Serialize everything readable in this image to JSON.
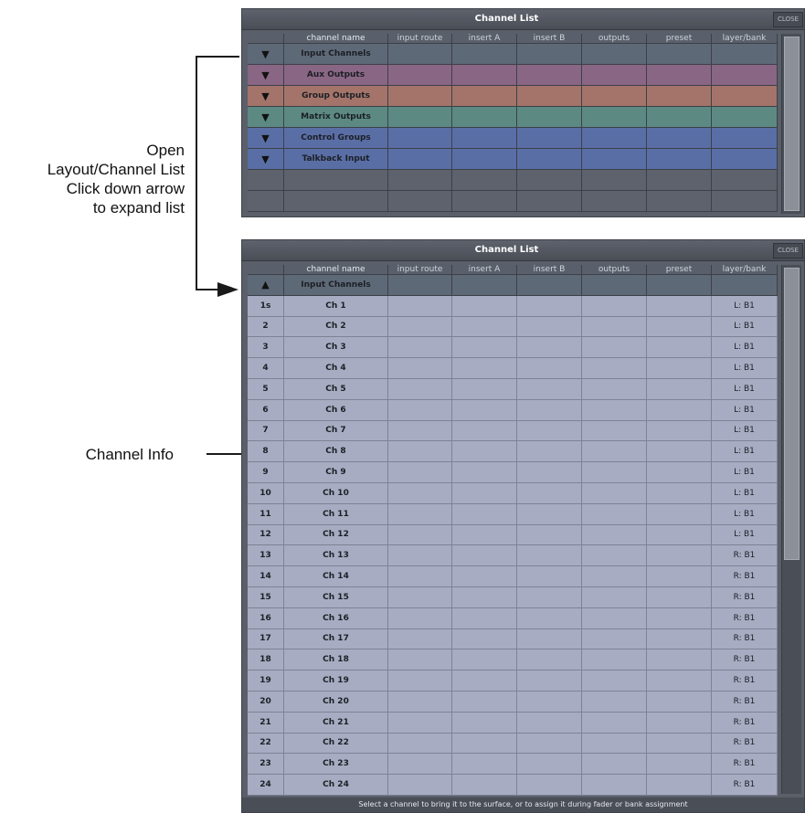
{
  "annotations": {
    "open_lines": [
      "Open",
      "Layout/Channel List",
      "Click down arrow",
      "to expand list"
    ],
    "channel_info": "Channel Info"
  },
  "top_window": {
    "title": "Channel List",
    "close_label": "CLOSE",
    "headers": [
      "",
      "channel name",
      "input route",
      "insert A",
      "insert B",
      "outputs",
      "preset",
      "layer/bank"
    ],
    "groups": [
      {
        "arrow": "▼",
        "name": "Input Channels",
        "color": "#5e6977"
      },
      {
        "arrow": "▼",
        "name": "Aux Outputs",
        "color": "#8a6685"
      },
      {
        "arrow": "▼",
        "name": "Group Outputs",
        "color": "#a4746a"
      },
      {
        "arrow": "▼",
        "name": "Matrix Outputs",
        "color": "#5c8a82"
      },
      {
        "arrow": "▼",
        "name": "Control Groups",
        "color": "#5a6ea6"
      },
      {
        "arrow": "▼",
        "name": "Talkback Input",
        "color": "#5a6ea6"
      }
    ]
  },
  "bottom_window": {
    "title": "Channel List",
    "close_label": "CLOSE",
    "headers": [
      "",
      "channel name",
      "input route",
      "insert A",
      "insert B",
      "outputs",
      "preset",
      "layer/bank"
    ],
    "group_row": {
      "arrow": "▲",
      "name": "Input Channels"
    },
    "channels": [
      {
        "num": "1s",
        "name": "Ch 1",
        "bank": "L: B1"
      },
      {
        "num": "2",
        "name": "Ch 2",
        "bank": "L: B1"
      },
      {
        "num": "3",
        "name": "Ch 3",
        "bank": "L: B1"
      },
      {
        "num": "4",
        "name": "Ch 4",
        "bank": "L: B1"
      },
      {
        "num": "5",
        "name": "Ch 5",
        "bank": "L: B1"
      },
      {
        "num": "6",
        "name": "Ch 6",
        "bank": "L: B1"
      },
      {
        "num": "7",
        "name": "Ch 7",
        "bank": "L: B1"
      },
      {
        "num": "8",
        "name": "Ch 8",
        "bank": "L: B1"
      },
      {
        "num": "9",
        "name": "Ch 9",
        "bank": "L: B1"
      },
      {
        "num": "10",
        "name": "Ch 10",
        "bank": "L: B1"
      },
      {
        "num": "11",
        "name": "Ch 11",
        "bank": "L: B1"
      },
      {
        "num": "12",
        "name": "Ch 12",
        "bank": "L: B1"
      },
      {
        "num": "13",
        "name": "Ch 13",
        "bank": "R: B1"
      },
      {
        "num": "14",
        "name": "Ch 14",
        "bank": "R: B1"
      },
      {
        "num": "15",
        "name": "Ch 15",
        "bank": "R: B1"
      },
      {
        "num": "16",
        "name": "Ch 16",
        "bank": "R: B1"
      },
      {
        "num": "17",
        "name": "Ch 17",
        "bank": "R: B1"
      },
      {
        "num": "18",
        "name": "Ch 18",
        "bank": "R: B1"
      },
      {
        "num": "19",
        "name": "Ch 19",
        "bank": "R: B1"
      },
      {
        "num": "20",
        "name": "Ch 20",
        "bank": "R: B1"
      },
      {
        "num": "21",
        "name": "Ch 21",
        "bank": "R: B1"
      },
      {
        "num": "22",
        "name": "Ch 22",
        "bank": "R: B1"
      },
      {
        "num": "23",
        "name": "Ch 23",
        "bank": "R: B1"
      },
      {
        "num": "24",
        "name": "Ch 24",
        "bank": "R: B1"
      }
    ],
    "status_text": "Select a channel to bring it to the surface, or to assign it during fader or bank assignment"
  },
  "colors": {
    "header": "#59606b",
    "empty_row": "#5d626d",
    "channel_row": "#a8acc2",
    "channel_row_border": "#7e8296",
    "window_bg": "#5a5f69"
  }
}
